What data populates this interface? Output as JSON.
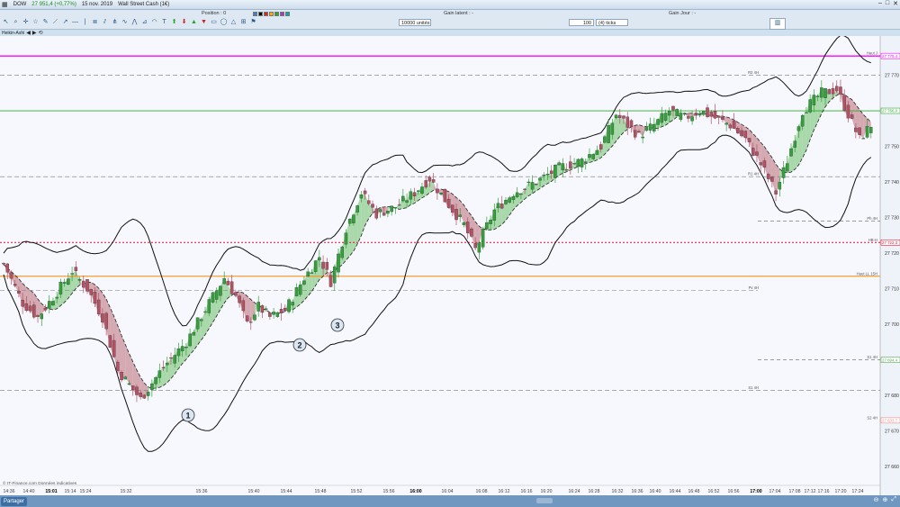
{
  "titlebar": {
    "instrument": "DOW",
    "price": "27 951,4 (+0,77%)",
    "date": "15 nov. 2019",
    "market": "Wall Street Cash (1€)"
  },
  "toolbar": {
    "position_label": "Position : 0",
    "gain_latent_label": "Gain latent : -",
    "gain_jour_label": "Gain Jour : -",
    "quantity_value": "10000 unités",
    "ticks_value": "100",
    "ticks_unit": "(4) ticks"
  },
  "nav": {
    "label": "Heikin-Ashi"
  },
  "statusbar": {
    "share_label": "Partager"
  },
  "colors": {
    "bull": "#35a035",
    "bear": "#b85060",
    "bull_cloud": "#8fcf8f",
    "bear_cloud": "#c98f97",
    "pink": "#ff00ff",
    "green_line": "#2ea82e",
    "orange": "#ff8800",
    "red_dotted": "#e3122f"
  },
  "chart_data": {
    "type": "candlestick",
    "y_range": [
      27655,
      27780
    ],
    "x_start": "14:36",
    "x_end": "17:28",
    "time_labels": [
      "14:36",
      "14:40",
      "15:01",
      "15:14",
      "15:24",
      "15:32",
      "15:36",
      "15:40",
      "15:44",
      "15:48",
      "15:52",
      "15:56",
      "16:00",
      "16:04",
      "16:08",
      "16:12",
      "16:16",
      "16:20",
      "16:24",
      "16:28",
      "16:32",
      "16:36",
      "16:40",
      "16:44",
      "16:48",
      "16:52",
      "16:56",
      "17:00",
      "17:04",
      "17:08",
      "17:12",
      "17:16",
      "17:20",
      "17:24"
    ],
    "price_labels": [
      "27 770",
      "27 760",
      "27 750",
      "27 740",
      "27 730",
      "27 720",
      "27 710",
      "27 700",
      "27 690",
      "27 680",
      "27 670",
      "27 660"
    ],
    "level_lines": [
      {
        "name": "pink",
        "label": "Haut J",
        "price_label": "27 775,4",
        "value": 27775.4,
        "style": "solid"
      },
      {
        "name": "r2",
        "label": "R2 4H",
        "price_label": "",
        "value": 27770,
        "style": "dashed"
      },
      {
        "name": "green",
        "label": "",
        "price_label": "27 766,0",
        "value": 27760,
        "style": "solid"
      },
      {
        "name": "r1",
        "label": "R1 4H",
        "price_label": "",
        "value": 27741.5,
        "style": "dashed"
      },
      {
        "name": "ph",
        "label": "Ph 4H",
        "price_label": "",
        "value": 27729,
        "style": "dashed-short"
      },
      {
        "name": "red",
        "label": "HB-H",
        "price_label": "27 722,3",
        "value": 27723,
        "style": "dotted"
      },
      {
        "name": "orange",
        "label": "Haut LL 15H",
        "price_label": "",
        "value": 27713.5,
        "style": "solid"
      },
      {
        "name": "pv",
        "label": "Pv 4H",
        "price_label": "",
        "value": 27709.5,
        "style": "dashed"
      },
      {
        "name": "s1a",
        "label": "S1 4H",
        "price_label": "27 694,4",
        "value": 27690,
        "style": "dashed-short"
      },
      {
        "name": "s1",
        "label": "S1 4H",
        "price_label": "",
        "value": 27681.5,
        "style": "dashed"
      },
      {
        "name": "s2",
        "label": "S2 4H",
        "price_label": "27 633,7",
        "value": 27673,
        "style": "none"
      }
    ],
    "annotations": [
      {
        "label": "1",
        "time": "15:36"
      },
      {
        "label": "2",
        "time": "15:40"
      },
      {
        "label": "3",
        "time": "15:48"
      }
    ],
    "source_text": "© IT-Finance.com Données indicatives"
  }
}
